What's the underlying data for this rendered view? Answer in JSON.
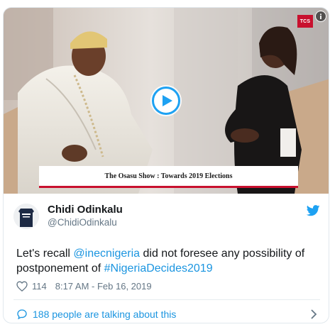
{
  "media": {
    "channel_logo": "TCS",
    "caption": "The Osasu Show : Towards 2019 Elections",
    "play_icon": "play-icon",
    "info_icon": "info-icon"
  },
  "author": {
    "name": "Chidi Odinkalu",
    "handle": "@ChidiOdinkalu",
    "avatar_icon": "avatar"
  },
  "tweet": {
    "text_before": "Let's recall ",
    "mention": "@inecnigeria",
    "text_middle": " did not foresee any possibility of postponement of ",
    "hashtag": "#NigeriaDecides2019"
  },
  "meta": {
    "like_count": "114",
    "timestamp": "8:17 AM - Feb 16, 2019"
  },
  "footer": {
    "talking_label": "188 people are talking about this"
  },
  "colors": {
    "link": "#1b95e0",
    "twitter_blue": "#1da1f2",
    "muted": "#657786",
    "banner_accent": "#c8102e"
  }
}
